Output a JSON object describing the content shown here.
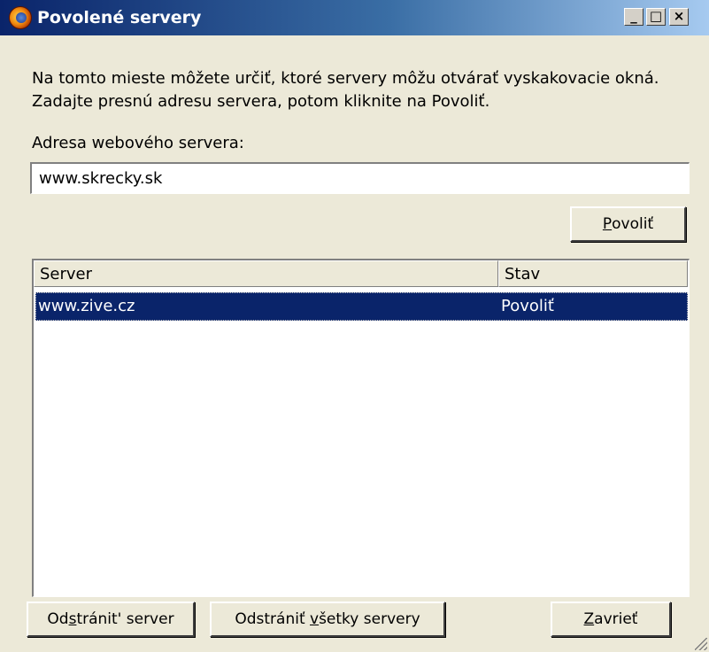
{
  "window": {
    "title": "Povolené servery",
    "controls": {
      "minimize": "_",
      "maximize": "□",
      "close": "×"
    },
    "icon": "firefox-icon"
  },
  "description": "Na tomto mieste môžete určiť, ktoré servery môžu otvárať vyskakovacie okná. Zadajte presnú adresu servera, potom kliknite na Povoliť.",
  "address": {
    "label": "Adresa webového servera:",
    "value": "www.skrecky.sk"
  },
  "allow_button": {
    "mnemonic": "P",
    "rest": "ovoliť"
  },
  "list": {
    "columns": [
      "Server",
      "Stav"
    ],
    "rows": [
      {
        "server": "www.zive.cz",
        "status": "Povoliť",
        "selected": true
      }
    ]
  },
  "buttons": {
    "remove_server": {
      "before": "Od",
      "mnemonic": "s",
      "after": "tránit' server"
    },
    "remove_all": {
      "before": "Odstrániť ",
      "mnemonic": "v",
      "after": "šetky servery"
    },
    "close": {
      "before": "",
      "mnemonic": "Z",
      "after": "avrieť"
    }
  },
  "colors": {
    "face": "#ece9d8",
    "selection": "#0a246a",
    "titlebar_start": "#0a246a",
    "titlebar_end": "#a6caf0"
  }
}
